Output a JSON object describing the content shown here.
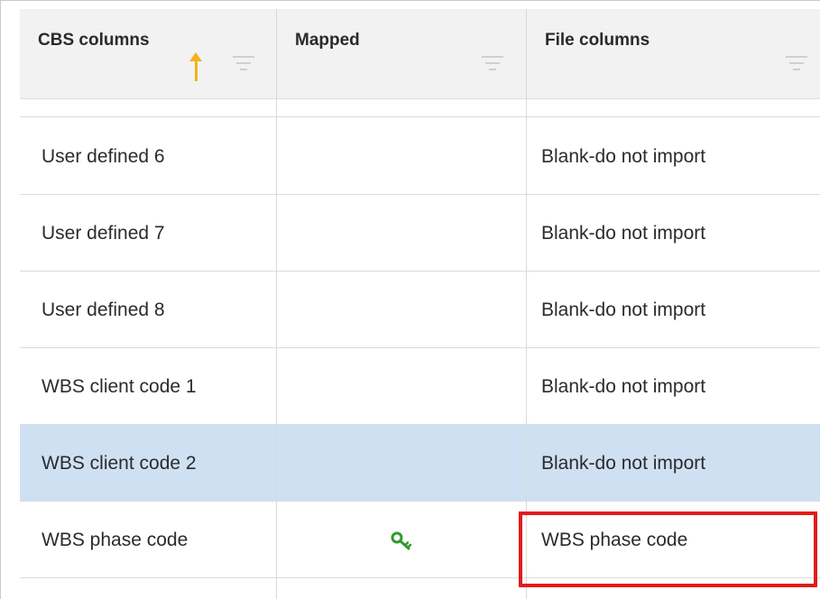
{
  "table": {
    "columns": [
      {
        "label": "CBS columns",
        "sorted": "ascending"
      },
      {
        "label": "Mapped"
      },
      {
        "label": "File columns"
      }
    ],
    "rows": [
      {
        "cbs": "User defined 6",
        "mapped": "",
        "file": "Blank-do not import",
        "selected": false
      },
      {
        "cbs": "User defined 7",
        "mapped": "",
        "file": "Blank-do not import",
        "selected": false
      },
      {
        "cbs": "User defined 8",
        "mapped": "",
        "file": "Blank-do not import",
        "selected": false
      },
      {
        "cbs": "WBS client code 1",
        "mapped": "",
        "file": "Blank-do not import",
        "selected": false
      },
      {
        "cbs": "WBS client code 2",
        "mapped": "",
        "file": "Blank-do not import",
        "selected": true
      },
      {
        "cbs": "WBS phase code",
        "mapped": "key-icon",
        "file": "WBS phase code",
        "selected": false
      }
    ]
  },
  "colors": {
    "selected_row": "#cfe0f3",
    "sort_arrow": "#f3b21b",
    "key_icon": "#2e9b2e",
    "highlight": "#e31b1b"
  }
}
